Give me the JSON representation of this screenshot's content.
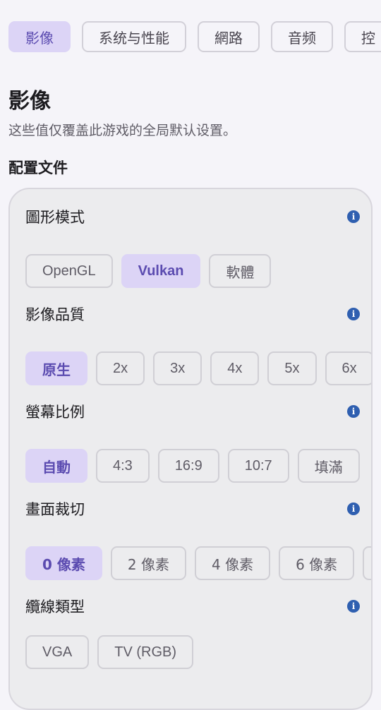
{
  "tabs": [
    {
      "label": "影像",
      "active": true
    },
    {
      "label": "系统与性能",
      "active": false
    },
    {
      "label": "網路",
      "active": false
    },
    {
      "label": "音频",
      "active": false
    },
    {
      "label": "控",
      "active": false
    }
  ],
  "page": {
    "title": "影像",
    "subtitle": "这些值仅覆盖此游戏的全局默认设置。",
    "section_label": "配置文件"
  },
  "settings": [
    {
      "label": "圖形模式",
      "info_icon": "info-icon",
      "options": [
        "OpenGL",
        "Vulkan",
        "軟體"
      ],
      "selected": "Vulkan"
    },
    {
      "label": "影像品質",
      "info_icon": "info-icon",
      "options": [
        "原生",
        "2x",
        "3x",
        "4x",
        "5x",
        "6x"
      ],
      "selected": "原生"
    },
    {
      "label": "螢幕比例",
      "info_icon": "info-icon",
      "options": [
        "自動",
        "4:3",
        "16:9",
        "10:7",
        "填滿"
      ],
      "selected": "自動"
    },
    {
      "label": "畫面裁切",
      "info_icon": "info-icon",
      "options": [
        "0 像素",
        "2 像素",
        "4 像素",
        "6 像素"
      ],
      "selected": "0 像素"
    },
    {
      "label": "纜線類型",
      "info_icon": "info-icon",
      "options": [
        "VGA",
        "TV (RGB)"
      ],
      "selected": "VGA"
    }
  ],
  "colors": {
    "accent": "#5b4bb0",
    "selected_bg": "#dcd4f6",
    "info_icon": "#2f5fb0"
  }
}
